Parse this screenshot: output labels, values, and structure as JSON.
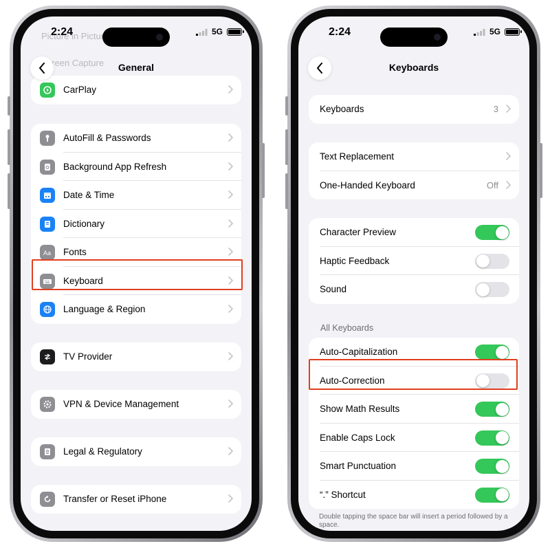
{
  "status": {
    "time": "2:24",
    "network": "5G"
  },
  "left": {
    "title": "General",
    "ghost_rows": [
      "Picture in Picture",
      "Screen Capture"
    ],
    "groups": [
      [
        {
          "label": "CarPlay",
          "icon": "carplay-icon",
          "color": "#34c759"
        }
      ],
      [
        {
          "label": "AutoFill & Passwords",
          "icon": "key-icon",
          "color": "#8e8e93"
        },
        {
          "label": "Background App Refresh",
          "icon": "refresh-icon",
          "color": "#8e8e93"
        },
        {
          "label": "Date & Time",
          "icon": "calendar-icon",
          "color": "#1a82f7"
        },
        {
          "label": "Dictionary",
          "icon": "book-icon",
          "color": "#1a82f7"
        },
        {
          "label": "Fonts",
          "icon": "fonts-icon",
          "color": "#8e8e93"
        },
        {
          "label": "Keyboard",
          "icon": "keyboard-icon",
          "color": "#8e8e93"
        },
        {
          "label": "Language & Region",
          "icon": "globe-icon",
          "color": "#1a82f7"
        }
      ],
      [
        {
          "label": "TV Provider",
          "icon": "tv-provider-icon",
          "color": "#1c1c1e"
        }
      ],
      [
        {
          "label": "VPN & Device Management",
          "icon": "gear-icon",
          "color": "#8e8e93"
        }
      ],
      [
        {
          "label": "Legal & Regulatory",
          "icon": "document-icon",
          "color": "#8e8e93"
        }
      ],
      [
        {
          "label": "Transfer or Reset iPhone",
          "icon": "reset-icon",
          "color": "#8e8e93"
        }
      ]
    ]
  },
  "right": {
    "title": "Keyboards",
    "group1": [
      {
        "label": "Keyboards",
        "value": "3"
      }
    ],
    "group2": [
      {
        "label": "Text Replacement",
        "value": ""
      },
      {
        "label": "One-Handed Keyboard",
        "value": "Off"
      }
    ],
    "group3": [
      {
        "label": "Character Preview",
        "on": true
      },
      {
        "label": "Haptic Feedback",
        "on": false
      },
      {
        "label": "Sound",
        "on": false
      }
    ],
    "section_header": "All Keyboards",
    "group4": [
      {
        "label": "Auto-Capitalization",
        "on": true
      },
      {
        "label": "Auto-Correction",
        "on": false
      },
      {
        "label": "Show Math Results",
        "on": true
      },
      {
        "label": "Enable Caps Lock",
        "on": true
      },
      {
        "label": "Smart Punctuation",
        "on": true
      },
      {
        "label": "“.” Shortcut",
        "on": true
      }
    ],
    "footnote": "Double tapping the space bar will insert a period followed by a space."
  },
  "colors": {
    "highlight": "#e23d1d",
    "toggle_on": "#34c759",
    "toggle_off": "#e3e3e8"
  }
}
